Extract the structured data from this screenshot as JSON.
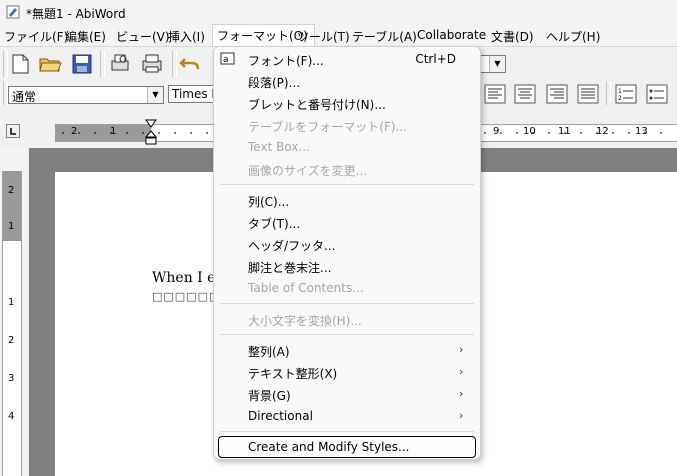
{
  "window": {
    "title": "*無題1 - AbiWord"
  },
  "menubar": {
    "items": [
      {
        "label": "ファイル(F)"
      },
      {
        "label": "編集(E)"
      },
      {
        "label": "ビュー(V)"
      },
      {
        "label": "挿入(I)"
      },
      {
        "label": "フォーマット(O)"
      },
      {
        "label": "ツール(T)"
      },
      {
        "label": "テーブル(A)"
      },
      {
        "label": "Collaborate"
      },
      {
        "label": "文書(D)"
      },
      {
        "label": "ヘルプ(H)"
      }
    ]
  },
  "toolbar": {
    "style_value": "通常",
    "font_value": "Times N",
    "size_dropdown_arrow": "▼"
  },
  "ruler": {
    "h_labels": [
      "2",
      "1",
      "9",
      "10",
      "11",
      "12",
      "13"
    ],
    "v_labels": [
      "2",
      "1",
      "1",
      "2",
      "3",
      "4"
    ]
  },
  "document": {
    "line1": "When I e",
    "line2": "□□□□□□"
  },
  "format_menu": {
    "items": [
      {
        "label": "フォント(F)...",
        "shortcut": "Ctrl+D",
        "enabled": true
      },
      {
        "label": "段落(P)...",
        "enabled": true
      },
      {
        "label": "ブレットと番号付け(N)...",
        "enabled": true
      },
      {
        "label": "テーブルをフォーマット(F)...",
        "enabled": false
      },
      {
        "label": "Text Box...",
        "enabled": false
      },
      {
        "label": "画像のサイズを変更...",
        "enabled": false
      },
      {
        "label": "列(C)...",
        "enabled": true
      },
      {
        "label": "タブ(T)...",
        "enabled": true
      },
      {
        "label": "ヘッダ/フッタ...",
        "enabled": true
      },
      {
        "label": "脚注と巻末注...",
        "enabled": true
      },
      {
        "label": "Table of Contents...",
        "enabled": false
      },
      {
        "label": "大小文字を変換(H)...",
        "enabled": false
      },
      {
        "label": "整列(A)",
        "submenu": true,
        "enabled": true
      },
      {
        "label": "テキスト整形(X)",
        "submenu": true,
        "enabled": true
      },
      {
        "label": "背景(G)",
        "submenu": true,
        "enabled": true
      },
      {
        "label": "Directional",
        "submenu": true,
        "enabled": true
      },
      {
        "label": "Create and Modify Styles...",
        "enabled": true,
        "highlighted": true
      }
    ],
    "submenu_arrow": "›"
  },
  "colors": {
    "menu_bg": "#f9f9f9",
    "disabled_text": "#a6a6a6",
    "workspace_grey": "#808080"
  }
}
